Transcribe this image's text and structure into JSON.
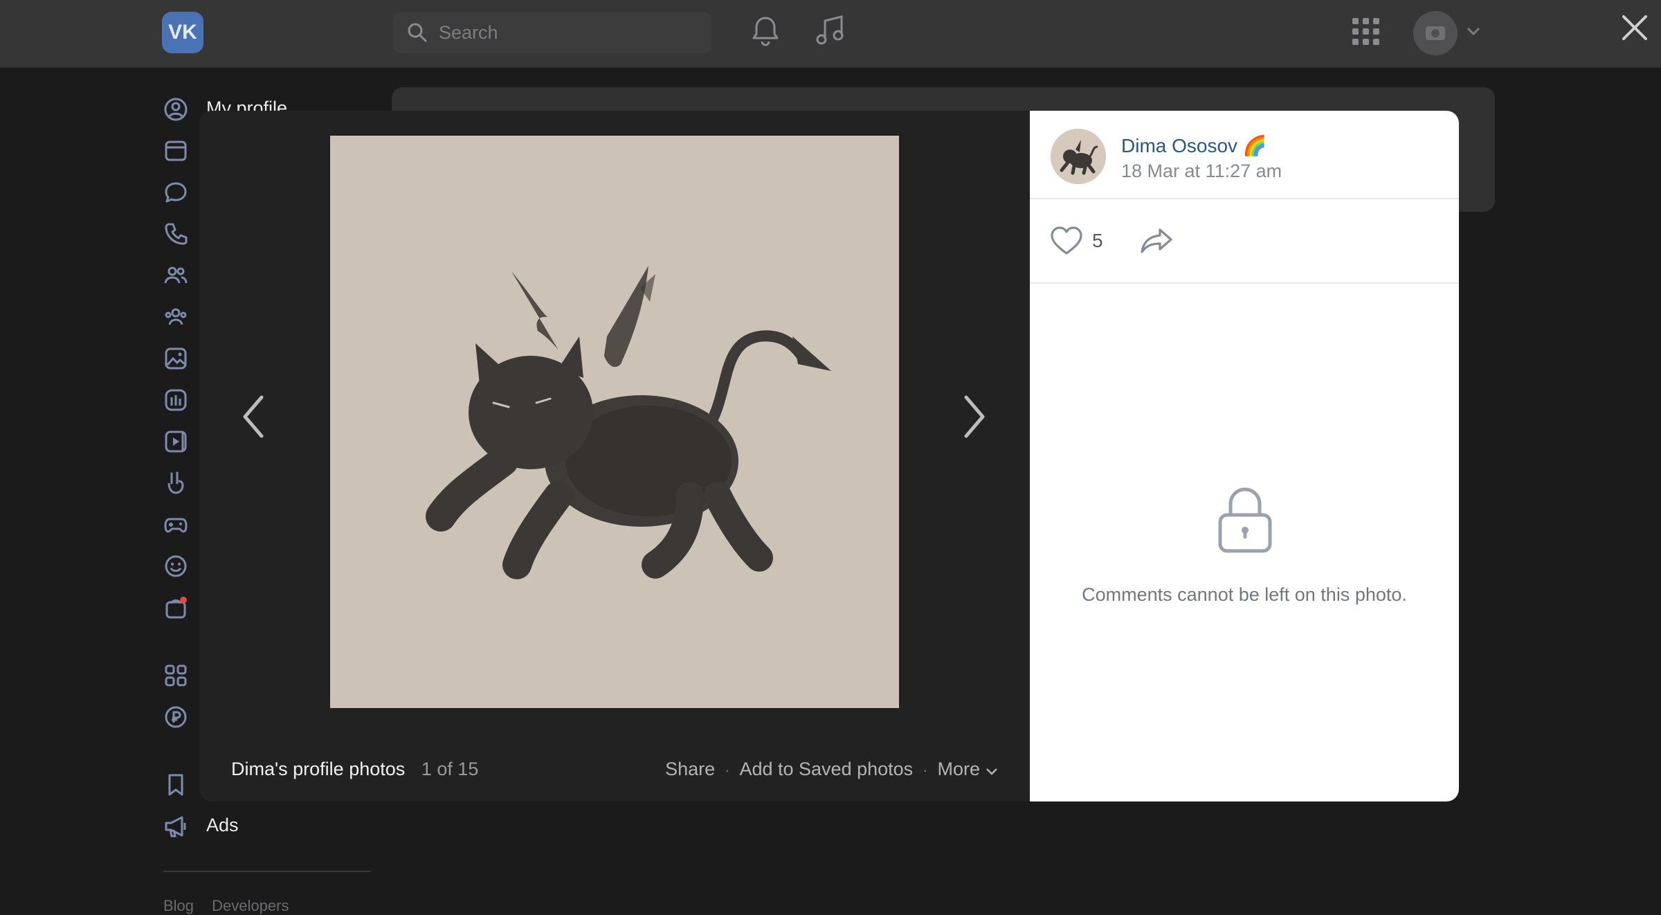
{
  "header": {
    "logo_text": "VK",
    "search_placeholder": "Search"
  },
  "sidebar": {
    "items": [
      {
        "label": "My profile",
        "icon": "user-circle-icon"
      },
      {
        "label": "",
        "icon": "news-icon"
      },
      {
        "label": "",
        "icon": "messenger-icon"
      },
      {
        "label": "",
        "icon": "calls-icon"
      },
      {
        "label": "",
        "icon": "friends-icon"
      },
      {
        "label": "",
        "icon": "communities-icon"
      },
      {
        "label": "",
        "icon": "photos-icon"
      },
      {
        "label": "",
        "icon": "music-icon"
      },
      {
        "label": "",
        "icon": "video-icon"
      },
      {
        "label": "",
        "icon": "clips-icon"
      },
      {
        "label": "",
        "icon": "games-icon"
      },
      {
        "label": "",
        "icon": "stickers-icon"
      },
      {
        "label": "",
        "icon": "market-icon"
      },
      {
        "label": "",
        "icon": "services-icon"
      },
      {
        "label": "",
        "icon": "payments-icon"
      },
      {
        "label": "",
        "icon": "bookmarks-icon"
      },
      {
        "label": "Ads",
        "icon": "megaphone-icon"
      }
    ],
    "footer_links": [
      "Blog",
      "Developers"
    ]
  },
  "viewer": {
    "album_title": "Dima's profile photos",
    "counter": "1 of 15",
    "actions": {
      "share": "Share",
      "save": "Add to Saved photos",
      "more": "More"
    },
    "author": {
      "name": "Dima Ososov 🌈",
      "date": "18 Mar at 11:27 am"
    },
    "likes": "5",
    "comments_message": "Comments cannot be left on this photo."
  },
  "colors": {
    "link": "#2a5885",
    "muted": "#818c99",
    "backdrop": "#1b1b1c",
    "photo_bg": "#ccc2b6"
  }
}
